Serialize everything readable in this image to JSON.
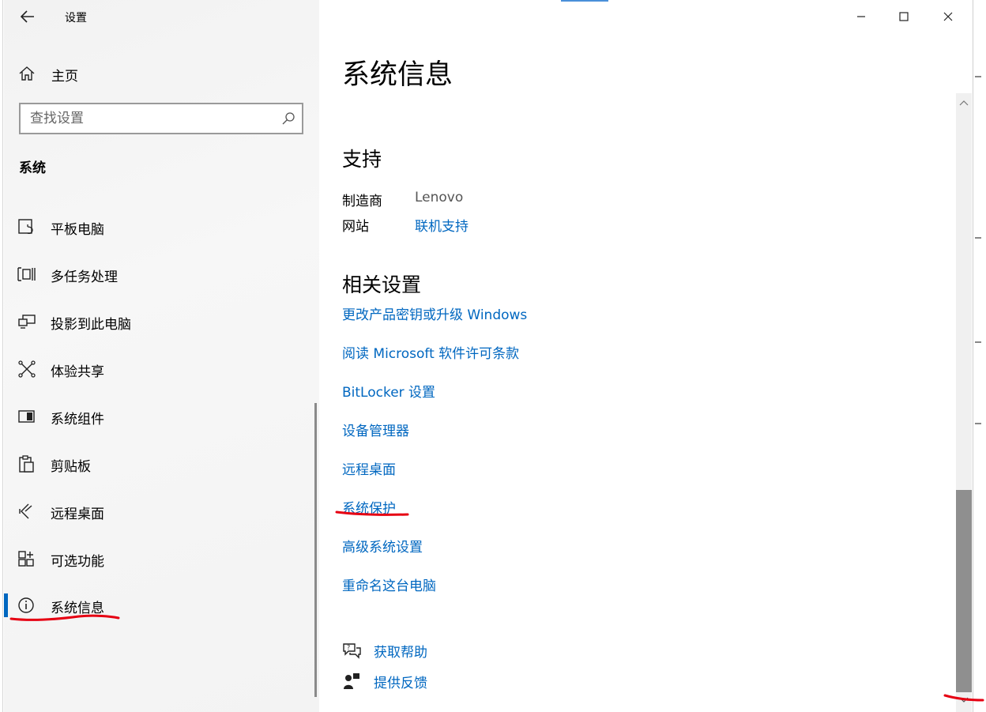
{
  "window": {
    "title": "设置",
    "controls": {
      "minimize": "minimize",
      "maximize": "maximize",
      "close": "close"
    }
  },
  "sidebar": {
    "home_label": "主页",
    "search_placeholder": "查找设置",
    "section_title": "系统",
    "items": [
      {
        "label": "平板电脑",
        "icon": "tablet-icon"
      },
      {
        "label": "多任务处理",
        "icon": "multitasking-icon"
      },
      {
        "label": "投影到此电脑",
        "icon": "project-icon"
      },
      {
        "label": "体验共享",
        "icon": "shared-experience-icon"
      },
      {
        "label": "系统组件",
        "icon": "system-components-icon"
      },
      {
        "label": "剪贴板",
        "icon": "clipboard-icon"
      },
      {
        "label": "远程桌面",
        "icon": "remote-desktop-icon"
      },
      {
        "label": "可选功能",
        "icon": "optional-features-icon"
      },
      {
        "label": "系统信息",
        "icon": "info-icon",
        "selected": true
      }
    ]
  },
  "main": {
    "title": "系统信息",
    "support": {
      "heading": "支持",
      "manufacturer_label": "制造商",
      "manufacturer_value": "Lenovo",
      "website_label": "网站",
      "website_link": "联机支持"
    },
    "related": {
      "heading": "相关设置",
      "links": [
        "更改产品密钥或升级 Windows",
        "阅读 Microsoft 软件许可条款",
        "BitLocker 设置",
        "设备管理器",
        "远程桌面",
        "系统保护",
        "高级系统设置",
        "重命名这台电脑"
      ]
    },
    "help": {
      "get_help": "获取帮助",
      "feedback": "提供反馈"
    }
  },
  "colors": {
    "accent": "#0067c0",
    "annotation": "#e60012",
    "sidebar_bg": "#f2f2f2"
  }
}
